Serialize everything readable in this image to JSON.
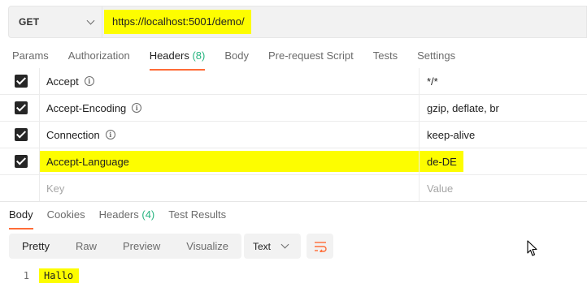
{
  "request": {
    "method": "GET",
    "url": "https://localhost:5001/demo/"
  },
  "request_tabs": [
    {
      "label": "Params"
    },
    {
      "label": "Authorization"
    },
    {
      "label": "Headers",
      "count": "(8)",
      "active": true
    },
    {
      "label": "Body"
    },
    {
      "label": "Pre-request Script"
    },
    {
      "label": "Tests"
    },
    {
      "label": "Settings"
    }
  ],
  "headers": [
    {
      "key": "Accept",
      "value": "*/*",
      "checked": true
    },
    {
      "key": "Accept-Encoding",
      "value": "gzip, deflate, br",
      "checked": true
    },
    {
      "key": "Connection",
      "value": "keep-alive",
      "checked": true
    },
    {
      "key": "Accept-Language",
      "value": "de-DE",
      "checked": true
    }
  ],
  "new_row": {
    "key_placeholder": "Key",
    "value_placeholder": "Value"
  },
  "response_tabs": [
    {
      "label": "Body",
      "active": true
    },
    {
      "label": "Cookies"
    },
    {
      "label": "Headers",
      "count": "(4)"
    },
    {
      "label": "Test Results"
    }
  ],
  "format_buttons": [
    {
      "label": "Pretty",
      "active": true
    },
    {
      "label": "Raw"
    },
    {
      "label": "Preview"
    },
    {
      "label": "Visualize"
    }
  ],
  "response_type": "Text",
  "response_body": [
    {
      "line": "1",
      "text": "Hallo"
    }
  ],
  "colors": {
    "highlight": "#fdfd00",
    "accent": "#ff6c37",
    "count": "#26b47f"
  },
  "icons": {
    "info": "info-circle-icon",
    "chevron": "chevron-down-icon",
    "wrap": "wrap-lines-icon",
    "cursor": "mouse-pointer-icon"
  }
}
